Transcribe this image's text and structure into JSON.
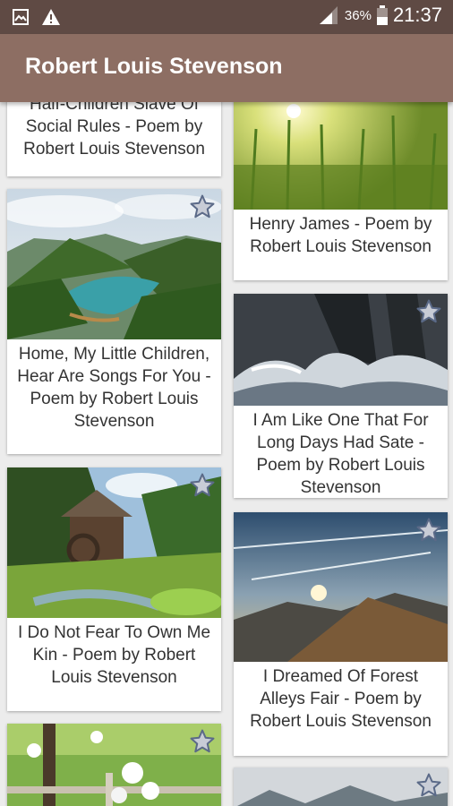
{
  "status_bar": {
    "battery_percent": "36%",
    "time": "21:37",
    "icons": [
      "image-icon",
      "warning-icon",
      "signal-icon",
      "battery-icon"
    ]
  },
  "app_bar": {
    "title": "Robert Louis Stevenson"
  },
  "colors": {
    "status_bar": "#5f4a44",
    "app_bar": "#8d6e63",
    "background": "#ececec",
    "star": "#6f7d99"
  },
  "poems": {
    "left": [
      {
        "title": "Half-Children Slave Of Social Rules - Poem by Robert Louis Stevenson",
        "image": "partially-scrolled",
        "favorite_icon": "star-outline-icon"
      },
      {
        "title": "Home, My Little Children, Hear Are Songs For You - Poem by Robert Louis Stevenson",
        "image": "mountain-lake",
        "favorite_icon": "star-outline-icon"
      },
      {
        "title": "I Do Not Fear To Own Me Kin - Poem by Robert Louis Stevenson",
        "image": "watermill-forest",
        "favorite_icon": "star-outline-icon"
      },
      {
        "title": "",
        "image": "blossom-fence",
        "favorite_icon": "star-outline-icon"
      }
    ],
    "right": [
      {
        "title": "Henry James - Poem by Robert Louis Stevenson",
        "image": "wheat-field-sunset",
        "favorite_icon": "star-outline-icon"
      },
      {
        "title": "I Am Like One That For Long Days Had Sate - Poem by Robert Louis Stevenson",
        "image": "ocean-waves-rocks",
        "favorite_icon": "star-outline-icon"
      },
      {
        "title": "I Dreamed Of Forest Alleys Fair - Poem by Robert Louis Stevenson",
        "image": "mountain-sunset-sky",
        "favorite_icon": "star-outline-icon"
      },
      {
        "title": "",
        "image": "cloudy-mountains",
        "favorite_icon": "star-outline-icon"
      }
    ]
  }
}
